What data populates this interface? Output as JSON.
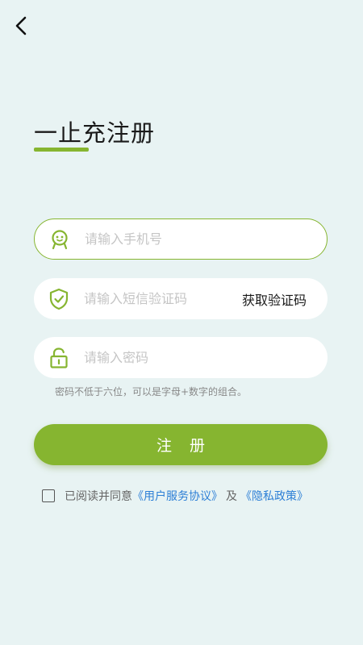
{
  "page": {
    "title": "一止充注册",
    "accent_color": "#86b530",
    "background_color": "#e8f3f3"
  },
  "nav": {
    "back_icon": "chevron-left-icon"
  },
  "form": {
    "phone": {
      "placeholder": "请输入手机号",
      "icon": "user-face-icon",
      "value": ""
    },
    "sms": {
      "placeholder": "请输入短信验证码",
      "icon": "shield-check-icon",
      "get_code_label": "获取验证码",
      "value": ""
    },
    "password": {
      "placeholder": "请输入密码",
      "icon": "unlock-icon",
      "value": ""
    },
    "password_hint": "密码不低于六位，可以是字母+数字的组合。"
  },
  "register_button": {
    "label": "注册"
  },
  "agreement": {
    "checked": false,
    "prefix": "已阅读并同意",
    "user_agreement": "《用户服务协议》",
    "conjunction": "及",
    "privacy_policy": "《隐私政策》",
    "link_color": "#2d7fd6"
  }
}
